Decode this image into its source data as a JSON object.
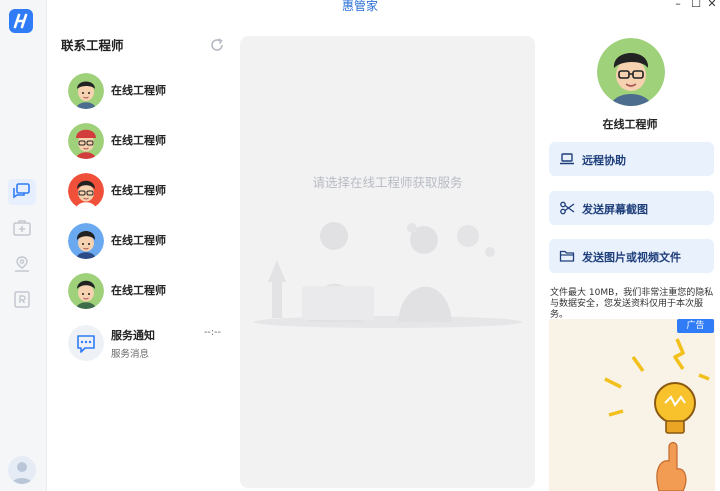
{
  "window": {
    "title": "惠管家",
    "minimize_glyph": "–",
    "maximize_glyph": "☐",
    "close_glyph": "✕"
  },
  "sidebar": {
    "items": [
      {
        "icon": "chat-bubbles-icon",
        "active": true
      },
      {
        "icon": "medical-kit-icon",
        "active": false
      },
      {
        "icon": "location-pin-icon",
        "active": false
      },
      {
        "icon": "r-document-icon",
        "active": false
      }
    ]
  },
  "contacts": {
    "title": "联系工程师",
    "engineers": [
      {
        "name": "在线工程师"
      },
      {
        "name": "在线工程师"
      },
      {
        "name": "在线工程师"
      },
      {
        "name": "在线工程师"
      },
      {
        "name": "在线工程师"
      }
    ],
    "notice": {
      "title": "服务通知",
      "subtitle": "服务消息",
      "time": "--:--"
    }
  },
  "main": {
    "hint": "请选择在线工程师获取服务"
  },
  "profile": {
    "name": "在线工程师",
    "actions": [
      {
        "label": "远程协助",
        "icon": "laptop-icon"
      },
      {
        "label": "发送屏幕截图",
        "icon": "scissors-icon"
      },
      {
        "label": "发送图片或视频文件",
        "icon": "folder-icon"
      }
    ],
    "disclaimer": "文件最大 10MB，我们非常注重您的隐私与数据安全，您发送资料仅用于本次服务。",
    "ad_badge": "广告"
  },
  "colors": {
    "accent": "#2f7cf6",
    "action_bg": "#e9f1fd",
    "panel_bg": "#f2f2f3"
  }
}
